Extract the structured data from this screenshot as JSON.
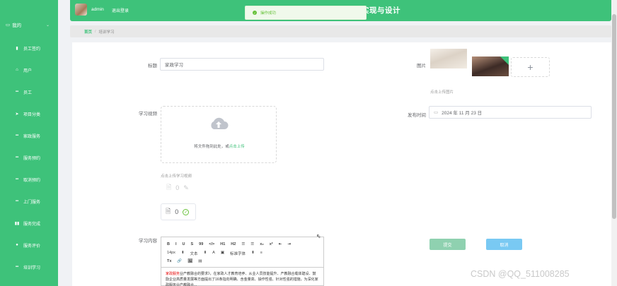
{
  "colors": {
    "brand": "#3ec27a",
    "success": "#67c23a",
    "submit": "#8fd1b0",
    "cancel": "#79c9f3"
  },
  "sidebar": {
    "header": "我的",
    "items": [
      {
        "label": "员工签约",
        "icon": "briefcase-icon"
      },
      {
        "label": "用户",
        "icon": "home-icon"
      },
      {
        "label": "员工",
        "icon": "grid-icon"
      },
      {
        "label": "项目分类",
        "icon": "send-icon"
      },
      {
        "label": "家政服务",
        "icon": "grid-icon"
      },
      {
        "label": "服务预约",
        "icon": "grid-icon"
      },
      {
        "label": "取消预约",
        "icon": "grid-icon"
      },
      {
        "label": "上门服务",
        "icon": "grid-icon"
      },
      {
        "label": "服务完成",
        "icon": "bar-chart-icon"
      },
      {
        "label": "服务评价",
        "icon": "user-icon"
      },
      {
        "label": "培训学习",
        "icon": "grid-icon"
      }
    ]
  },
  "header": {
    "user": "admin",
    "logout": "退出登录",
    "title": "实现与设计"
  },
  "toast": {
    "text": "操作成功"
  },
  "breadcrumb": {
    "home": "首页",
    "current": "培训学习"
  },
  "form": {
    "title_label": "标题",
    "title_value": "家政学习",
    "image_label": "图片",
    "image_hint": "点击上传图片",
    "video_label": "学习视频",
    "upload_text": "将文件拖到此处，或",
    "upload_link": "点击上传",
    "video_hint": "点击上传学习视频",
    "file_count": "0",
    "date_label": "发布时间",
    "date_value": "2024 年 11 月 23 日",
    "content_label": "学习内容",
    "submit": "提交",
    "cancel": "取消"
  },
  "editor": {
    "toolbar1": [
      "B",
      "I",
      "U",
      "S",
      "99",
      "</>",
      "H1",
      "H2",
      "☰",
      "☰",
      "x₂",
      "x²",
      "⇤",
      "⇥"
    ],
    "toolbar2": [
      "14px",
      "⬍",
      "文本",
      "⬍",
      "A",
      "▣",
      "标准字体",
      "⬍",
      "≡"
    ],
    "toolbar3": [
      "Tx",
      "🔗",
      "🖼",
      "▤"
    ],
    "highlight": "家政服务",
    "body": "业产教融合的要求》，在家政人才教育培养、从业人员技能提升、产教融合载体建设、鼓励企业高质量发展等方面提出了16条指向明确、含金量高、操作性强、针对性强的措施，为深化家政服务业产教融合..."
  },
  "watermark": "CSDN @QQ_511008285"
}
